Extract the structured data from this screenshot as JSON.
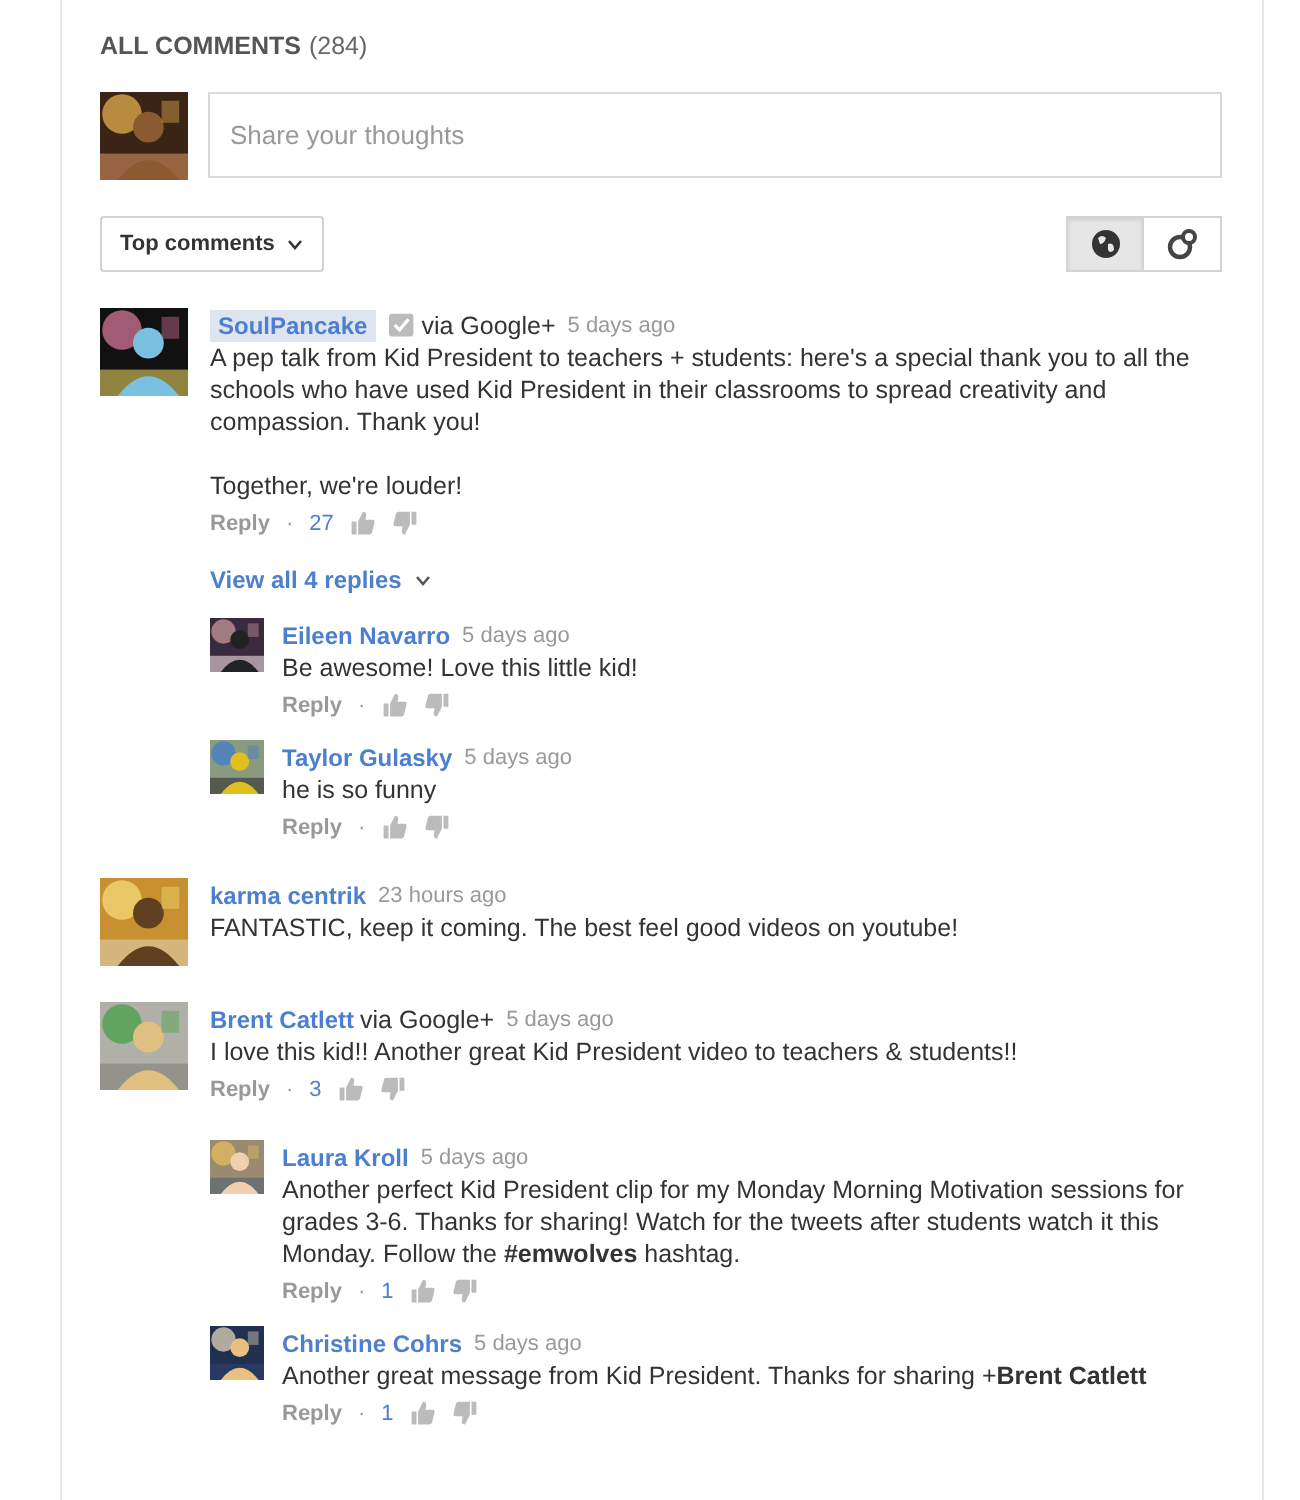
{
  "header": {
    "title": "ALL COMMENTS",
    "count": "(284)"
  },
  "composer": {
    "placeholder": "Share your thoughts"
  },
  "sort": {
    "label": "Top comments"
  },
  "filters": [
    {
      "kind": "globe",
      "selected": true
    },
    {
      "kind": "circles",
      "selected": false
    }
  ],
  "comments": [
    {
      "author": "SoulPancake",
      "highlighted": true,
      "verified": true,
      "via": "via Google+",
      "time": "5 days ago",
      "paragraphs": [
        "A pep talk from Kid President to teachers + students: here's a special thank you to all the schools who have used Kid President in their classrooms to spread creativity and compassion. Thank you!",
        "Together, we're louder!"
      ],
      "reply": "Reply",
      "separator": "·",
      "likes": "27",
      "expander": "View all 4 replies",
      "replies": [
        {
          "author": "Eileen Navarro",
          "highlighted": false,
          "verified": false,
          "time": "5 days ago",
          "paragraphs": [
            "Be awesome! Love this little kid!"
          ],
          "reply": "Reply",
          "separator": "·"
        },
        {
          "author": "Taylor Gulasky",
          "highlighted": false,
          "verified": false,
          "time": "5 days ago",
          "paragraphs": [
            "he is so funny"
          ],
          "reply": "Reply",
          "separator": "·"
        }
      ]
    },
    {
      "author": "karma centrik",
      "highlighted": false,
      "verified": false,
      "time": "23 hours ago",
      "paragraphs": [
        "FANTASTIC, keep it coming. The best feel good videos on youtube!"
      ]
    },
    {
      "author": "Brent Catlett",
      "highlighted": false,
      "verified": false,
      "via": "via Google+",
      "time": "5 days ago",
      "paragraphs": [
        "I love this kid!! Another great Kid President video to teachers & students!!"
      ],
      "reply": "Reply",
      "separator": "·",
      "likes": "3",
      "replies": [
        {
          "author": "Laura Kroll",
          "highlighted": false,
          "verified": false,
          "time": "5 days ago",
          "paragraphs": [
            "Another perfect Kid President clip for my Monday Morning Motivation sessions for grades 3-6. Thanks for sharing! Watch for the tweets after students watch it this Monday. Follow the **#emwolves** hashtag."
          ],
          "reply": "Reply",
          "separator": "·",
          "likes": "1"
        },
        {
          "author": "Christine Cohrs",
          "highlighted": false,
          "verified": false,
          "time": "5 days ago",
          "paragraphs": [
            "Another great message from  Kid President. Thanks for sharing +**Brent Catlett**"
          ],
          "reply": "Reply",
          "separator": "·",
          "likes": "1"
        }
      ]
    }
  ]
}
